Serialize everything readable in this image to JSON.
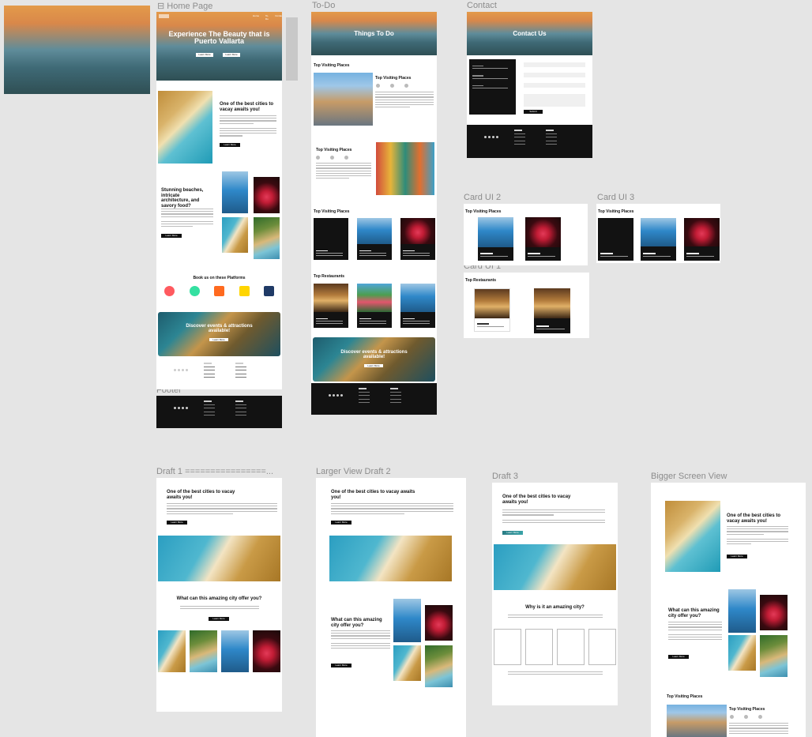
{
  "canvas": {
    "background": "#e5e5e5",
    "frame_labels": {
      "home": "Home Page",
      "todo": "To-Do",
      "contact": "Contact",
      "footer": "Footer",
      "card_ui_2": "Card UI 2",
      "card_ui_3": "Card UI 3",
      "card_ui_1": "Card UI 1",
      "draft1": "Draft 1 ================...",
      "draft2": "Larger View Draft 2",
      "draft3": "Draft 3",
      "bigger": "Bigger Screen View"
    }
  },
  "home": {
    "logo_icon": "frame-icon",
    "nav": [
      "Home",
      "To-Do",
      "Contact"
    ],
    "hero_title": "Experience The Beauty that is Puerto Vallarta",
    "hero_buttons": [
      "Learn More",
      "Learn More"
    ],
    "section1_title": "One of the best cities to vacay awaits you!",
    "section1_button": "Learn More",
    "section2_title": "Stunning beaches, intricate architecture, and savory food?",
    "section2_button": "Learn More",
    "platforms_title": "Book us on these Platforms",
    "platform_colors": [
      "#ff5a5f",
      "#34e0a1",
      "#ff6a1f",
      "#ffd500",
      "#1f3a66"
    ],
    "banner_title": "Discover events & attractions available!",
    "banner_button": "Learn More"
  },
  "todo": {
    "hero_title": "Things To Do",
    "top_visiting_1": "Top Visiting Places",
    "top_visiting_2": "Top Visiting Places",
    "top_visiting_3": "Top Visiting Places",
    "top_visiting_4": "Top Visiting Places",
    "top_restaurants": "Top Restaurants",
    "banner_title": "Discover events & attractions available!",
    "banner_button": "Learn More"
  },
  "contact": {
    "hero_title": "Contact Us",
    "button": "Submit"
  },
  "cards": {
    "card2_title": "Top Visiting Places",
    "card3_title": "Top Visiting Places",
    "card1_title": "Top Restaurants"
  },
  "draft1": {
    "title": "One of the best cities to vacay awaits you!",
    "button": "Learn More",
    "section_title": "What can this amazing city offer you?",
    "section_button": "Learn More"
  },
  "draft2": {
    "title": "One of the best cities to vacay awaits you!",
    "button": "Learn More",
    "section_title": "What can this amazing city offer you?",
    "section_button": "Learn More"
  },
  "draft3": {
    "title": "One of the best cities to vacay awaits you!",
    "button": "Learn More",
    "section_title": "Why is it an amazing city?"
  },
  "bigger": {
    "title": "One of the best cities to vacay awaits you!",
    "button": "Learn More",
    "section_title": "What can this amazing city offer you?",
    "section_button": "Learn More",
    "top_title": "Top Visiting Places",
    "top_title_2": "Top Visiting Places"
  }
}
